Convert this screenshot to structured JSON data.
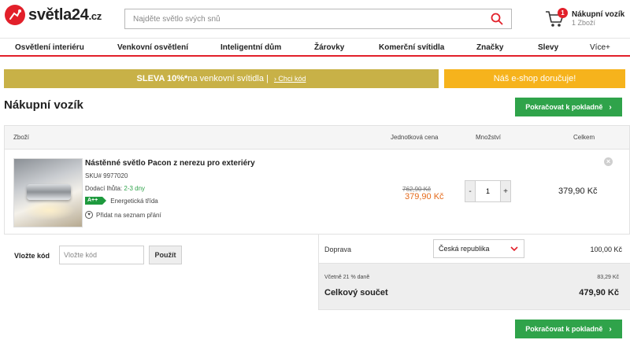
{
  "header": {
    "logo_text": "světla24",
    "logo_tld": ".cz",
    "search_placeholder": "Najděte světlo svých snů",
    "cart_title": "Nákupní vozík",
    "cart_count_text": "1 Zboží",
    "cart_badge": "1"
  },
  "nav": {
    "items": [
      "Osvětlení interiéru",
      "Venkovní osvětlení",
      "Inteligentní dům",
      "Žárovky",
      "Komerční svítidla",
      "Značky",
      "Slevy"
    ],
    "more": "Více+"
  },
  "banners": {
    "sale_bold": "SLEVA 10%*",
    "sale_text": "na venkovní svítidla |",
    "sale_link": "› Chci kód",
    "shipping": "Náš e-shop doručuje!"
  },
  "page_title": "Nákupní vozík",
  "checkout_label": "Pokračovat k pokladně",
  "table": {
    "headers": {
      "product": "Zboží",
      "unit_price": "Jednotková cena",
      "quantity": "Množství",
      "total": "Celkem"
    }
  },
  "item": {
    "name": "Nástěnné světlo Pacon z nerezu pro exteriéry",
    "sku": "SKU# 9977020",
    "delivery_label": "Dodací lhůta:",
    "delivery_value": "2-3 dny",
    "energy_class": "A++",
    "energy_label": "Energetická třída",
    "wishlist_label": "Přidat na seznam přání",
    "old_price": "762,90 Kč",
    "price": "379,90 Kč",
    "quantity": "1",
    "qty_minus": "-",
    "qty_plus": "+",
    "line_total": "379,90 Kč"
  },
  "coupon": {
    "label": "Vložte kód",
    "placeholder": "Vložte kód",
    "button": "Použít"
  },
  "summary": {
    "shipping_label": "Doprava",
    "shipping_country": "Česká republika",
    "shipping_price": "100,00 Kč",
    "vat_label": "Včetně 21 % daně",
    "vat_value": "83,29 Kč",
    "total_label": "Celkový součet",
    "total_value": "479,90 Kč"
  },
  "colors": {
    "brand_red": "#e2202a",
    "checkout_green": "#2fa34a",
    "sale_banner": "#c8b147",
    "shipping_banner": "#f6b31c",
    "sale_price": "#e46a1b"
  }
}
